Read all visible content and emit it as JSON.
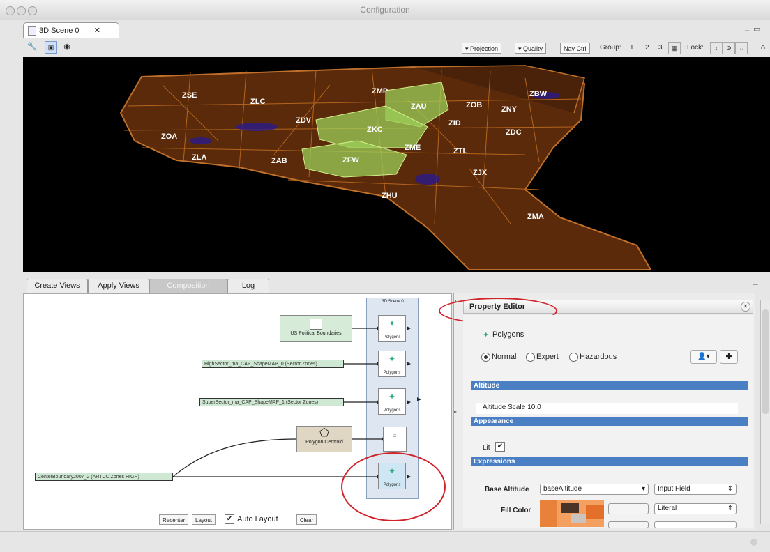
{
  "window": {
    "title": "Configuration"
  },
  "scene_tab": {
    "label": "3D Scene 0",
    "close": "✕"
  },
  "window_controls": {
    "min": "–",
    "max": "▭"
  },
  "toolbar": {
    "projection": "▾ Projection",
    "quality": "▾ Quality",
    "nav": "Nav Ctrl",
    "group_label": "Group:",
    "groups": [
      "1",
      "2",
      "3"
    ],
    "lock_label": "Lock:"
  },
  "map": {
    "regions": [
      "ZSE",
      "ZLC",
      "ZMP",
      "ZAU",
      "ZOB",
      "ZBW",
      "ZNY",
      "ZDV",
      "ZKC",
      "ZID",
      "ZDC",
      "ZOA",
      "ZME",
      "ZTL",
      "ZLA",
      "ZAB",
      "ZFW",
      "ZJX",
      "ZHU",
      "ZMA"
    ],
    "colors": {
      "land": "#5a2a0a",
      "border": "#b5651d",
      "highlight": "#9ccf5a",
      "water": "#000000"
    }
  },
  "panel_tabs": [
    "Create Views",
    "Apply Views",
    "Composition",
    "Log"
  ],
  "graph": {
    "scene_node": "3D Scene 0",
    "sources": [
      "US Political Boundaries",
      "HighSector_ma_CAP_ShapeMAP_0 (Sector Zones)",
      "SuperSector_ma_CAP_ShapeMAP_1 (Sector Zones)",
      "Polygon Centroid",
      "CenterBoundary2007_2 (ARTCC Zones HIGH)"
    ],
    "node_label": "Polygons",
    "buttons": {
      "recenter": "Recenter",
      "layout": "Layout",
      "auto_layout": "Auto Layout",
      "clear": "Clear"
    }
  },
  "property_editor": {
    "title": "Property Editor",
    "layer": "Polygons",
    "modes": [
      "Normal",
      "Expert",
      "Hazardous"
    ],
    "sections": {
      "altitude": "Altitude",
      "appearance": "Appearance",
      "expressions": "Expressions"
    },
    "altitude_scale_label": "Altitude Scale",
    "altitude_scale_value": "10.0",
    "lit_label": "Lit",
    "base_altitude_label": "Base Altitude",
    "base_altitude_value": "baseAltitude",
    "base_altitude_type": "Input Field",
    "fill_color_label": "Fill Color",
    "fill_color_type": "Literal"
  }
}
